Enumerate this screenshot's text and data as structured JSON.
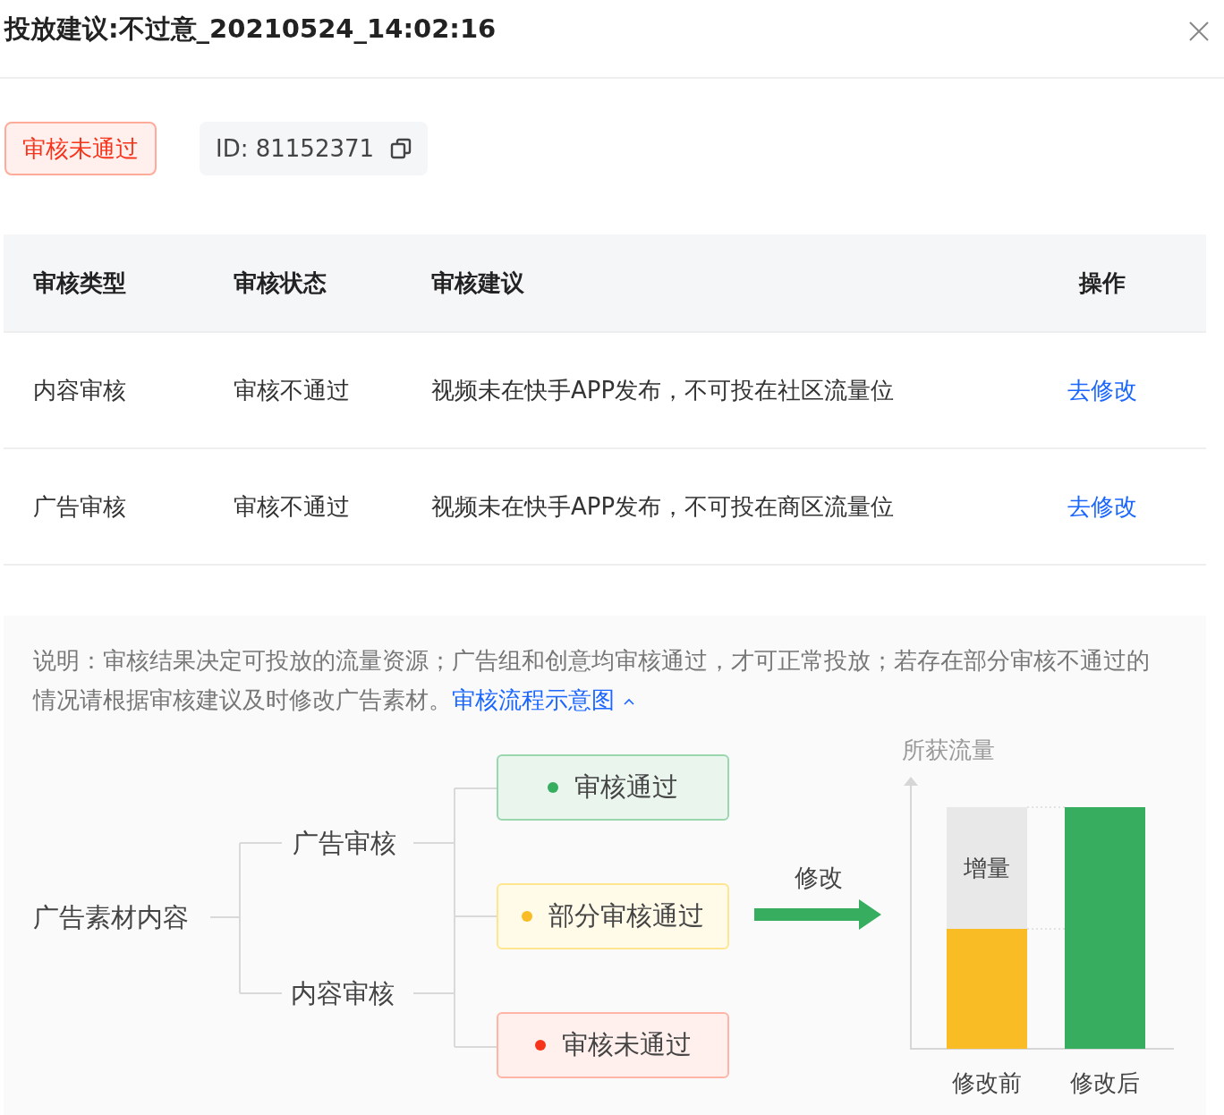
{
  "dialog": {
    "title": "投放建议:不过意_20210524_14:02:16"
  },
  "status_tag": {
    "text": "审核未通过",
    "kind": "rejected"
  },
  "id_chip": {
    "text": "ID: 81152371"
  },
  "table": {
    "columns": [
      "审核类型",
      "审核状态",
      "审核建议",
      "操作"
    ],
    "rows": [
      {
        "type": "内容审核",
        "status": "审核不通过",
        "advice": "视频未在快手APP发布，不可投在社区流量位",
        "action": "去修改"
      },
      {
        "type": "广告审核",
        "status": "审核不通过",
        "advice": "视频未在快手APP发布，不可投在商区流量位",
        "action": "去修改"
      }
    ]
  },
  "explanation": {
    "text": "说明：审核结果决定可投放的流量资源；广告组和创意均审核通过，才可正常投放；若存在部分审核不通过的情况请根据审核建议及时修改广告素材。",
    "link": "审核流程示意图",
    "expanded": true
  },
  "diagram": {
    "root": "广告素材内容",
    "branches": [
      "广告审核",
      "内容审核"
    ],
    "outcomes": [
      {
        "label": "审核通过",
        "kind": "pass"
      },
      {
        "label": "部分审核通过",
        "kind": "partial"
      },
      {
        "label": "审核未通过",
        "kind": "fail"
      }
    ],
    "arrow_label": "修改",
    "chart": {
      "axis_label": "所获流量",
      "increment_label": "增量",
      "categories": [
        "修改前",
        "修改后"
      ]
    }
  }
}
